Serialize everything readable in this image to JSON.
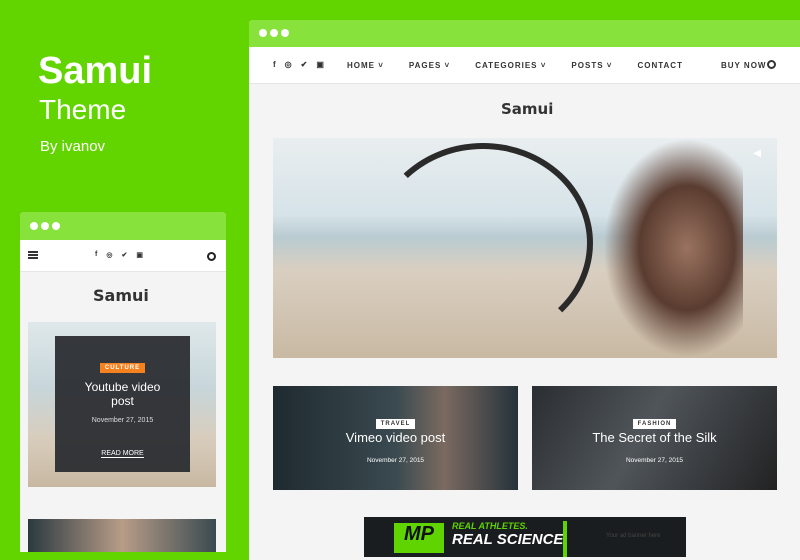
{
  "promo": {
    "title": "Samui",
    "subtitle": "Theme",
    "author": "By ivanov"
  },
  "desktop": {
    "social": [
      "f",
      "◎",
      "🐦",
      "▣"
    ],
    "menu": [
      "HOME ˅",
      "PAGES ˅",
      "CATEGORIES ˅",
      "POSTS ˅",
      "CONTACT",
      "BUY NOW"
    ],
    "logo": "Samui",
    "cards": [
      {
        "category": "TRAVEL",
        "title": "Vimeo video post",
        "date": "November 27, 2015"
      },
      {
        "category": "FASHION",
        "title": "The Secret of the Silk",
        "date": "November 27, 2015"
      }
    ],
    "ad": {
      "line1": "REAL ATHLETES.",
      "line2": "REAL SCIENCE.",
      "brand": "MP",
      "placeholder": "Your ad banner here"
    }
  },
  "mobile": {
    "social": [
      "f",
      "◎",
      "🐦",
      "▣"
    ],
    "logo": "Samui",
    "post": {
      "category": "CULTURE",
      "title": "Youtube video post",
      "date": "November 27, 2015",
      "read_more": "READ MORE"
    }
  },
  "colors": {
    "bg": "#62d400",
    "titlebar": "#88e23c",
    "badge_culture": "#f5821f"
  }
}
